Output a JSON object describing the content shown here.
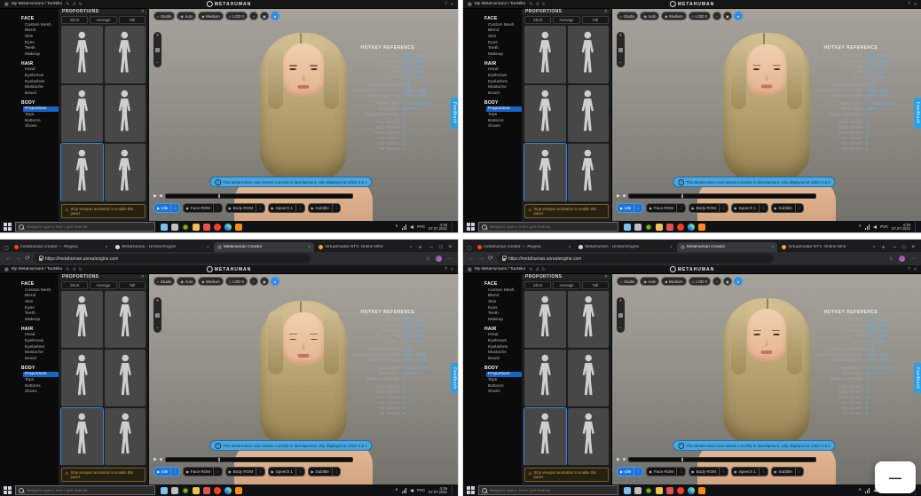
{
  "page": {
    "overlay_button_label": "—"
  },
  "shared": {
    "topbar": {
      "breadcrumb": "My MetaHumans / TaoNiko",
      "logo_text": "METAHUMAN",
      "left_icons": [
        {
          "name": "apps-grid",
          "glyph": "▦"
        }
      ],
      "edit_icons": [
        {
          "name": "rename-pencil",
          "glyph": "✎"
        },
        {
          "name": "undo",
          "glyph": "↺"
        },
        {
          "name": "redo",
          "glyph": "↻"
        }
      ],
      "right_icons": [
        {
          "name": "help",
          "glyph": "?"
        },
        {
          "name": "menu",
          "glyph": "≡"
        }
      ]
    },
    "sidebar": {
      "sections": [
        {
          "title": "FACE",
          "items": [
            {
              "label": "Custom Mesh"
            },
            {
              "label": "Blend"
            },
            {
              "label": "Skin"
            },
            {
              "label": "Eyes"
            },
            {
              "label": "Teeth"
            },
            {
              "label": "Makeup"
            }
          ]
        },
        {
          "title": "HAIR",
          "items": [
            {
              "label": "Head"
            },
            {
              "label": "Eyebrows"
            },
            {
              "label": "Eyelashes"
            },
            {
              "label": "Mustache"
            },
            {
              "label": "Beard"
            }
          ]
        },
        {
          "title": "BODY",
          "items": [
            {
              "label": "Proportions",
              "active": true
            },
            {
              "label": "Tops"
            },
            {
              "label": "Bottoms"
            },
            {
              "label": "Shoes"
            }
          ]
        }
      ]
    },
    "panel": {
      "title": "PROPORTIONS",
      "close_glyph": "✕",
      "tabs": [
        "Short",
        "Average",
        "Tall"
      ],
      "thumbnails": [
        {},
        {},
        {},
        {},
        {
          "active": true
        },
        {}
      ],
      "warning": "Stop viewport animation to enable this panel",
      "warning_icon": "⚠"
    },
    "viewport": {
      "toolbar": [
        {
          "icon": "◐",
          "label": "Studio"
        },
        {
          "icon": "◉",
          "label": "Auto"
        },
        {
          "icon": "◆",
          "label": "Medium"
        },
        {
          "icon": "◇",
          "label": "LOD 0"
        }
      ],
      "toolbar_extras": [
        {
          "name": "viewport-option",
          "glyph": "+"
        },
        {
          "name": "screenshot",
          "glyph": "▣"
        }
      ],
      "preview_toggle_glyph": "●",
      "zoom_plus": "+",
      "zoom_minus": "−",
      "notice": "This MetaHuman uses assets currently in development, only displayed at LODs 0 & 1",
      "notice_icon": "i",
      "timeline": {
        "play": "▶",
        "stop": "■"
      },
      "anim_buttons": [
        {
          "label": "Idle",
          "active": true
        },
        {
          "label": "Face ROM"
        },
        {
          "label": "Body ROM"
        },
        {
          "label": "Speech 1"
        },
        {
          "label": "Subtitle"
        }
      ],
      "play_glyph": "▶",
      "kebab_glyph": "⋮",
      "feedback": "Feedback",
      "hotkeys": {
        "title": "HOTKEY REFERENCE",
        "rows": [
          {
            "k": "Rotate View",
            "v": "LMB + Drag"
          },
          {
            "k": "Pan View",
            "v": "MMB + Drag"
          },
          {
            "k": "Zoom View",
            "v": "RMB + Drag"
          },
          {
            "k": "Tilt",
            "v": "ALT + LMB"
          },
          {
            "k": "Zoom",
            "v": "ALT + RMB",
            "gap": true
          },
          {
            "k": "Move Sculpt Point",
            "v": "Drag"
          },
          {
            "k": "Move Sculpt Point Forward",
            "v": "CTRL + Drag"
          },
          {
            "k": "Reset Sculpt Point",
            "v": "SHIFT + LMB",
            "gap": true
          },
          {
            "k": "Rotate Lights",
            "v": "L + Mouse Move"
          },
          {
            "k": "Mouse Light",
            "v": "SHIFT + L"
          },
          {
            "k": "Toggle Clay Render",
            "v": "C",
            "gap": true
          },
          {
            "k": "Face Camera",
            "v": "1"
          },
          {
            "k": "Body Camera",
            "v": "2"
          },
          {
            "k": "Hand Camera",
            "v": "3"
          },
          {
            "k": "Legs Camera",
            "v": "4"
          },
          {
            "k": "Feet Camera",
            "v": "5"
          },
          {
            "k": "Far Camera",
            "v": "6"
          }
        ]
      }
    },
    "browser": {
      "tabs": [
        {
          "label": "metahuman creator — Яндекс",
          "color": "#fc3f1d"
        },
        {
          "label": "MetaHuman - Unreal Engine",
          "color": "#d8d8d8"
        },
        {
          "label": "MetaHuman Creator",
          "color": "#6b6b6b",
          "active": true
        },
        {
          "label": "VirtualAvatar NTV. Online Whit",
          "color": "#f5a623"
        }
      ],
      "tab_close_glyph": "×",
      "new_tab_glyph": "+",
      "nav": {
        "back": "←",
        "forward": "→",
        "reload": "⟳"
      },
      "url": "https://metahuman.unrealengine.com",
      "addr_icons": {
        "favorite": "☆",
        "more": "···"
      },
      "window_controls": {
        "min": "–",
        "max": "□",
        "close": "×"
      }
    },
    "taskbar": {
      "search_placeholder": "Введите здесь текст для поиска",
      "apps": [
        {
          "name": "widgets-weather",
          "color": "#78c2f3"
        },
        {
          "name": "task-view",
          "color": "#bfbfbf"
        },
        {
          "name": "geforce",
          "color": "#76b900"
        },
        {
          "name": "explorer",
          "color": "#f2c14e"
        },
        {
          "name": "defender",
          "color": "#e5534b"
        },
        {
          "name": "yandex-browser",
          "color": "#fc3f1d"
        },
        {
          "name": "edge",
          "color": "#35a3e8"
        },
        {
          "name": "unreal-app",
          "color": "#ff8c1a"
        }
      ],
      "tray_caret": "∧",
      "lang": "РУС",
      "time": "4:19",
      "date": "07.07.2022"
    },
    "accent": "#1864c7"
  },
  "quadrants": [
    {
      "pos": "top-left",
      "chrome": false
    },
    {
      "pos": "top-right",
      "chrome": false
    },
    {
      "pos": "bottom-left",
      "chrome": true
    },
    {
      "pos": "bottom-right",
      "chrome": true
    }
  ]
}
